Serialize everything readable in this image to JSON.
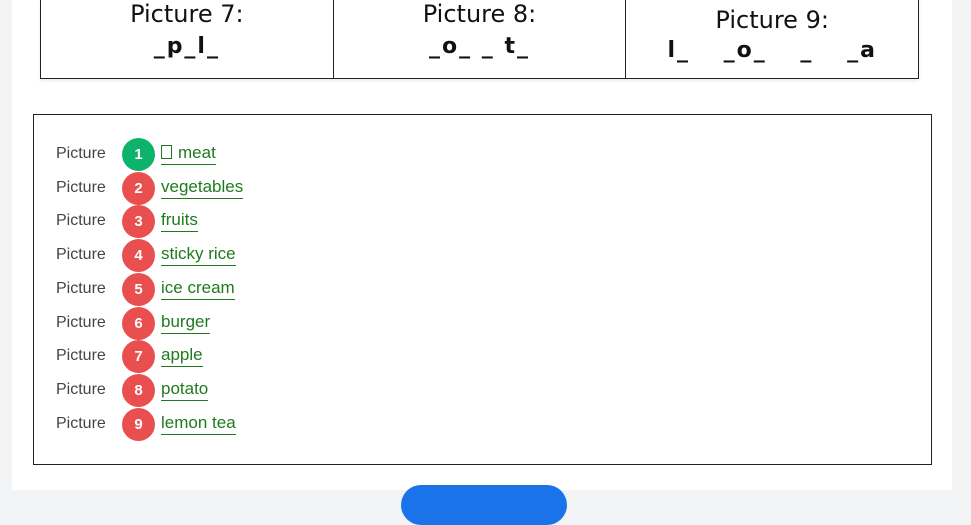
{
  "pictures": [
    {
      "title": "Picture 7:",
      "clue": "_p_l_"
    },
    {
      "title": "Picture 8:",
      "clue": "_o_ _ t_"
    },
    {
      "title": "Picture 9:",
      "clue": "l_ _o_  _ _a"
    }
  ],
  "answers": {
    "row_label": "Picture",
    "items": [
      {
        "number": "1",
        "text": "meat",
        "status": "correct"
      },
      {
        "number": "2",
        "text": "vegetables",
        "status": "wrong"
      },
      {
        "number": "3",
        "text": "fruits",
        "status": "wrong"
      },
      {
        "number": "4",
        "text": "sticky rice",
        "status": "wrong"
      },
      {
        "number": "5",
        "text": "ice cream",
        "status": "wrong"
      },
      {
        "number": "6",
        "text": "burger",
        "status": "wrong"
      },
      {
        "number": "7",
        "text": "apple",
        "status": "wrong"
      },
      {
        "number": "8",
        "text": "potato",
        "status": "wrong"
      },
      {
        "number": "9",
        "text": "lemon tea",
        "status": "wrong"
      }
    ]
  },
  "colors": {
    "correct": "#0db36a",
    "wrong": "#ea4f4f",
    "answer_text": "#1f7a1f",
    "button": "#1a73e8"
  }
}
